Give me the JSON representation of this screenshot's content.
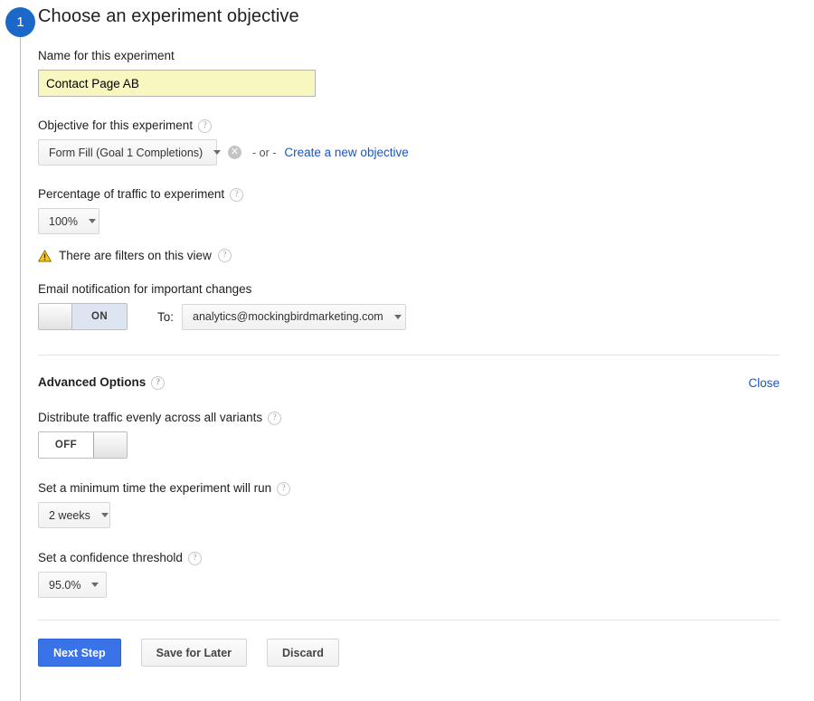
{
  "step": {
    "number": "1",
    "title": "Choose an experiment objective"
  },
  "fields": {
    "name": {
      "label": "Name for this experiment",
      "value": "Contact Page AB",
      "placeholder": ""
    },
    "objective": {
      "label": "Objective for this experiment",
      "selected": "Form Fill (Goal 1 Completions)",
      "clear_icon": "clear-circle-icon",
      "or_text": "- or -",
      "create_link": "Create a new objective",
      "help_icon": "help-icon"
    },
    "traffic_percentage": {
      "label": "Percentage of traffic to experiment",
      "selected": "100%",
      "help_icon": "help-icon"
    },
    "filters_warning": {
      "icon": "warning-triangle-icon",
      "text": "There are filters on this view",
      "help_icon": "help-icon"
    },
    "email_notification": {
      "label": "Email notification for important changes",
      "toggle_state": "ON",
      "to_label": "To:",
      "recipient": "analytics@mockingbirdmarketing.com"
    }
  },
  "advanced": {
    "header": "Advanced Options",
    "help_icon": "help-icon",
    "close_link": "Close",
    "distribute": {
      "label": "Distribute traffic evenly across all variants",
      "toggle_state": "OFF",
      "help_icon": "help-icon"
    },
    "min_time": {
      "label": "Set a minimum time the experiment will run",
      "selected": "2 weeks",
      "help_icon": "help-icon"
    },
    "confidence": {
      "label": "Set a confidence threshold",
      "selected": "95.0%",
      "help_icon": "help-icon"
    }
  },
  "actions": {
    "next": "Next Step",
    "save": "Save for Later",
    "discard": "Discard"
  },
  "colors": {
    "accent": "#3a72e8",
    "badge": "#1b68c9",
    "link": "#1a56c4",
    "input_autofill": "#f7f7bf",
    "warning": "#f5c518"
  }
}
